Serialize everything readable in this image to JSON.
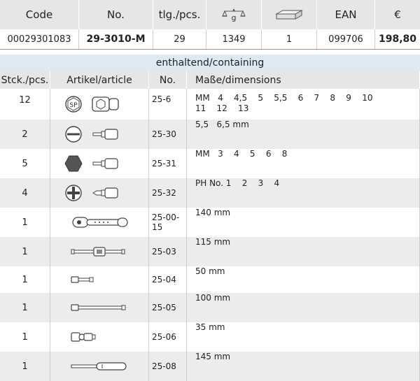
{
  "product": {
    "headers": {
      "code": "Code",
      "no": "No.",
      "pcs": "tlg./pcs.",
      "weight_icon": "scale-weight-g-icon",
      "box_icon": "box-icon",
      "ean": "EAN",
      "price": "€"
    },
    "values": {
      "code": "00029301083",
      "no": "29-3010-M",
      "pcs": "29",
      "weight": "1349",
      "box": "1",
      "ean": "099706",
      "price": "198,80"
    }
  },
  "containing": {
    "title": "enthaltend/containing",
    "headers": {
      "qty": "Stck./pcs.",
      "article": "Artikel/article",
      "no": "No.",
      "dimensions": "Maße/dimensions"
    },
    "rows": [
      {
        "qty": "12",
        "no": "25-6",
        "dim1": "MM   4    4,5    5    5,5    6    7    8    9    10",
        "dim2": "11    12    13",
        "icons": [
          "sp-symbol-icon",
          "socket-icon"
        ]
      },
      {
        "qty": "2",
        "no": "25-30",
        "dim1": "5,5   6,5 mm",
        "dim2": "",
        "icons": [
          "slotted-symbol-icon",
          "slotted-bit-socket-icon"
        ]
      },
      {
        "qty": "5",
        "no": "25-31",
        "dim1": "MM   3    4    5    6    8",
        "dim2": "",
        "icons": [
          "hex-symbol-icon",
          "hex-bit-socket-icon"
        ]
      },
      {
        "qty": "4",
        "no": "25-32",
        "dim1": "PH No. 1    2    3    4",
        "dim2": "",
        "icons": [
          "phillips-symbol-icon",
          "phillips-bit-socket-icon"
        ]
      },
      {
        "qty": "1",
        "no": "25-00-15",
        "dim1": "140 mm",
        "dim2": "",
        "icons": [
          "ratchet-icon"
        ]
      },
      {
        "qty": "1",
        "no": "25-03",
        "dim1": "115 mm",
        "dim2": "",
        "icons": [
          "t-handle-icon"
        ]
      },
      {
        "qty": "1",
        "no": "25-04",
        "dim1": "50 mm",
        "dim2": "",
        "icons": [
          "short-extension-icon"
        ]
      },
      {
        "qty": "1",
        "no": "25-05",
        "dim1": "100 mm",
        "dim2": "",
        "icons": [
          "long-extension-icon"
        ]
      },
      {
        "qty": "1",
        "no": "25-06",
        "dim1": "35 mm",
        "dim2": "",
        "icons": [
          "universal-joint-icon"
        ]
      },
      {
        "qty": "1",
        "no": "25-08",
        "dim1": "145 mm",
        "dim2": "",
        "icons": [
          "spinner-handle-icon"
        ]
      }
    ]
  }
}
